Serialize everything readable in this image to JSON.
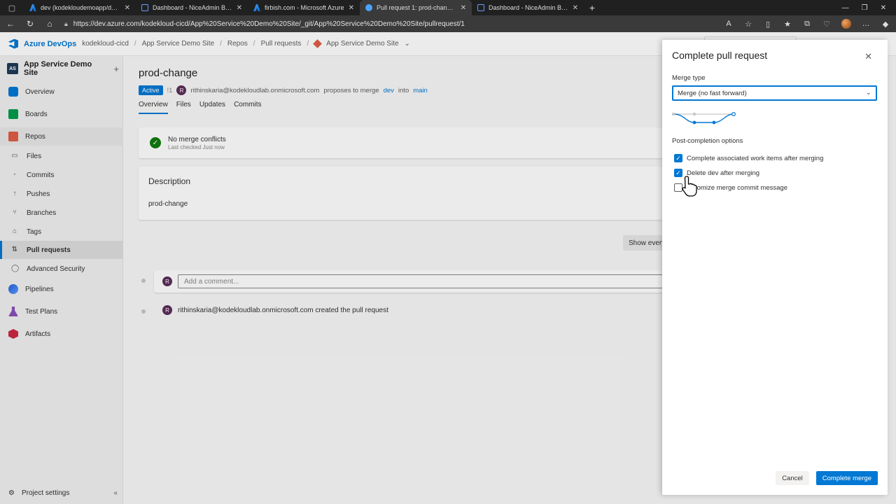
{
  "browser": {
    "tabs": [
      {
        "title": "dev (kodekloudemoapp/dev) - M",
        "icon": "azure-icon",
        "active": false
      },
      {
        "title": "Dashboard - NiceAdmin Bootstr",
        "icon": "doc-icon",
        "active": false
      },
      {
        "title": "firbish.com - Microsoft Azure",
        "icon": "azure-icon",
        "active": false
      },
      {
        "title": "Pull request 1: prod-change - Re",
        "icon": "devops-icon",
        "active": true
      },
      {
        "title": "Dashboard - NiceAdmin Bootstr",
        "icon": "doc-icon",
        "active": false
      }
    ],
    "url": "https://dev.azure.com/kodekloud-cicd/App%20Service%20Demo%20Site/_git/App%20Service%20Demo%20Site/pullrequest/1"
  },
  "topnav": {
    "brand": "Azure DevOps",
    "org": "kodekloud-cicd",
    "project": "App Service Demo Site",
    "section": "Repos",
    "page": "Pull requests",
    "repo": "App Service Demo Site"
  },
  "sidebar": {
    "project_avatar": "AS",
    "project_name": "App Service Demo Site",
    "add": "+",
    "items": [
      {
        "label": "Overview"
      },
      {
        "label": "Boards"
      },
      {
        "label": "Repos"
      },
      {
        "label": "Files"
      },
      {
        "label": "Commits"
      },
      {
        "label": "Pushes"
      },
      {
        "label": "Branches"
      },
      {
        "label": "Tags"
      },
      {
        "label": "Pull requests"
      },
      {
        "label": "Advanced Security"
      },
      {
        "label": "Pipelines"
      },
      {
        "label": "Test Plans"
      },
      {
        "label": "Artifacts"
      }
    ],
    "settings": "Project settings"
  },
  "pr": {
    "title": "prod-change",
    "status": "Active",
    "id": "!1",
    "author_initial": "R",
    "author": "rithinskaria@kodekloudlab.onmicrosoft.com",
    "proposes": "proposes to merge",
    "source": "dev",
    "into": "into",
    "target": "main",
    "tabs": [
      "Overview",
      "Files",
      "Updates",
      "Commits"
    ],
    "merge_status": "No merge conflicts",
    "last_checked": "Last checked Just now",
    "description_title": "Description",
    "description": "prod-change",
    "show_button": "Show every",
    "comment_placeholder": "Add a comment...",
    "activity": "rithinskaria@kodekloudlab.onmicrosoft.com created the pull request"
  },
  "panel": {
    "title": "Complete pull request",
    "merge_type_label": "Merge type",
    "merge_type_value": "Merge (no fast forward)",
    "post_label": "Post-completion options",
    "options": [
      {
        "label": "Complete associated work items after merging",
        "checked": true
      },
      {
        "label": "Delete dev after merging",
        "checked": true
      },
      {
        "label": "tomize merge commit message",
        "checked": false
      }
    ],
    "cancel": "Cancel",
    "complete": "Complete merge"
  },
  "colors": {
    "accent": "#0078d4",
    "success": "#107c10"
  }
}
